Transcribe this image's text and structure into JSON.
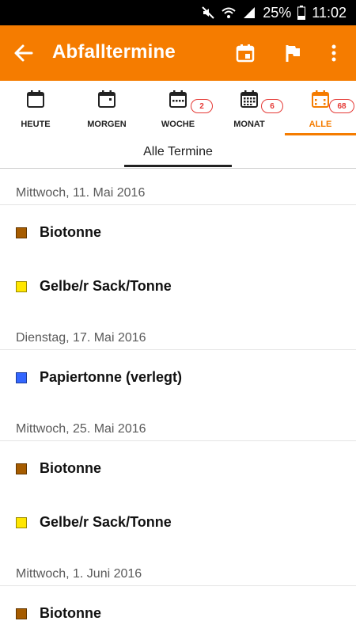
{
  "status_bar": {
    "battery": "25%",
    "time": "11:02"
  },
  "app_bar": {
    "title": "Abfalltermine"
  },
  "tabs": [
    {
      "label": "HEUTE",
      "icon": "calendar-icon",
      "badge": ""
    },
    {
      "label": "MORGEN",
      "icon": "calendar-icon",
      "badge": ""
    },
    {
      "label": "WOCHE",
      "icon": "calendar-week-icon",
      "badge": "2"
    },
    {
      "label": "MONAT",
      "icon": "calendar-month-icon",
      "badge": "6"
    },
    {
      "label": "ALLE",
      "icon": "calendar-all-icon",
      "badge": "68",
      "active": true
    }
  ],
  "subtab": {
    "label": "Alle Termine"
  },
  "colors": {
    "accent": "#f57c00",
    "bio": "#a65c00",
    "gelb": "#ffe600",
    "papier": "#3366ff",
    "badge": "#e53935"
  },
  "days": [
    {
      "date": "Mittwoch, 11. Mai 2016",
      "items": [
        {
          "name": "Biotonne",
          "color": "#a65c00"
        },
        {
          "name": "Gelbe/r Sack/Tonne",
          "color": "#ffe600"
        }
      ]
    },
    {
      "date": "Dienstag, 17. Mai 2016",
      "items": [
        {
          "name": "Papiertonne (verlegt)",
          "color": "#3366ff"
        }
      ]
    },
    {
      "date": "Mittwoch, 25. Mai 2016",
      "items": [
        {
          "name": "Biotonne",
          "color": "#a65c00"
        },
        {
          "name": "Gelbe/r Sack/Tonne",
          "color": "#ffe600"
        }
      ]
    },
    {
      "date": "Mittwoch, 1. Juni 2016",
      "items": [
        {
          "name": "Biotonne",
          "color": "#a65c00"
        }
      ]
    }
  ]
}
